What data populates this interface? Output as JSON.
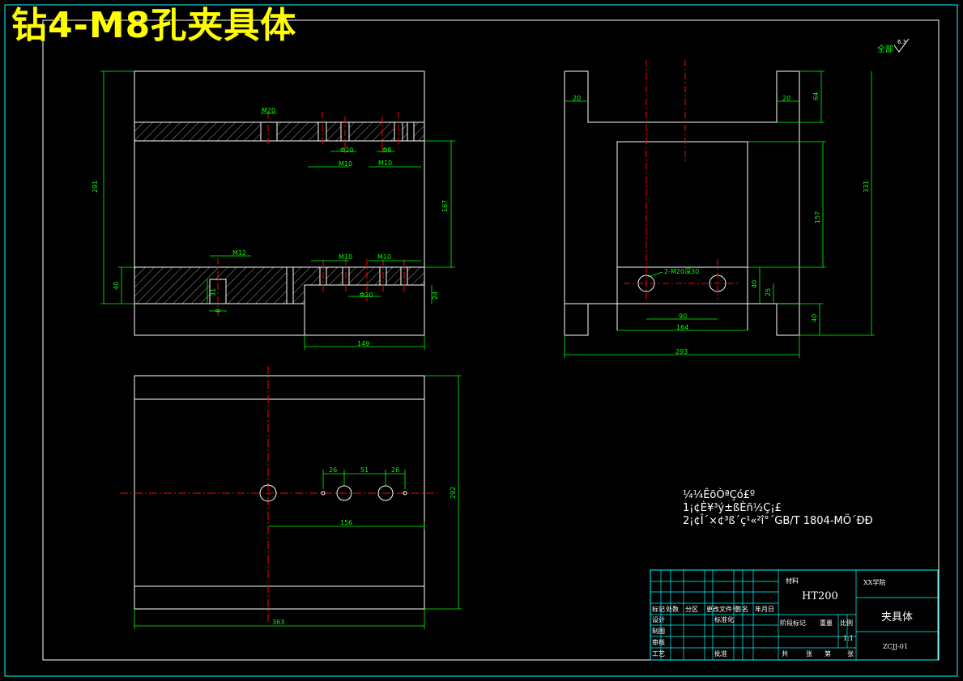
{
  "title": "钻4-M8孔夹具体",
  "roughness": {
    "prefix": "全部",
    "value": "6.3"
  },
  "front_view": {
    "dims": {
      "total_height": "291",
      "top_slot_m20": "M20",
      "top_m10_left": "M10",
      "top_m10_right": "M10",
      "top_small_1": "Φ20",
      "top_small_2": "Φ8",
      "height_167": "167",
      "m12": "M12",
      "mid_m10_left": "M10",
      "mid_m10_right": "M10",
      "bottom_40": "40",
      "depth_31": "31",
      "depth_8": "8",
      "small_bottom": "Φ20",
      "right_24": "24",
      "width_149": "149"
    }
  },
  "side_view": {
    "dims": {
      "left_20": "20",
      "right_20": "20",
      "top_64": "64",
      "total_331": "331",
      "height_157": "157",
      "holes": "2-M20深30",
      "h_40": "40",
      "h_25": "25",
      "bottom_40": "40",
      "spacing_90": "90",
      "width_164": "164",
      "total_293": "293"
    }
  },
  "top_view": {
    "dims": {
      "s26a": "26",
      "s51": "51",
      "s26b": "26",
      "s156": "156",
      "height_292": "292",
      "width_363": "363"
    }
  },
  "notes": {
    "heading": "¼¼ÊõÒªÇó£º",
    "line1": "1¡¢È¥³ý±ßÈñ½Ç¡£",
    "line2": "2¡¢Î´×¢³ß´ç¹«²î°´GB/T 1804-MÖ´ÐÐ"
  },
  "title_block": {
    "material_label": "材料",
    "material": "HT200",
    "school": "XX学院",
    "part_name": "夹具体",
    "drawing_no": "ZCJJ-01",
    "scale": "1:1",
    "row_labels": [
      "标记",
      "处数",
      "分区",
      "更改文件号",
      "签名",
      "年月日"
    ],
    "left_labels": [
      "设计",
      "制图",
      "审核",
      "工艺"
    ],
    "std_label": "标准化",
    "approve_label": "批准",
    "stage_label": "阶段标记",
    "weight_label": "重量",
    "ratio_label": "比例",
    "sheet_total": "共",
    "sheet_label": "张",
    "sheet_no": "第",
    "sheet_suffix": "张"
  }
}
